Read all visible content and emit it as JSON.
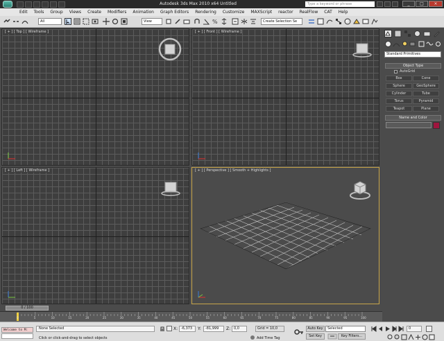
{
  "titlebar": {
    "title": "Autodesk 3ds Max 2010 x64     Untitled",
    "search_placeholder": "Type a keyword or phrase"
  },
  "menubar": {
    "items": [
      "Edit",
      "Tools",
      "Group",
      "Views",
      "Create",
      "Modifiers",
      "Animation",
      "Graph Editors",
      "Rendering",
      "Customize",
      "MAXScript",
      "reactor",
      "RealFlow",
      "CAT",
      "Help"
    ]
  },
  "toolbar": {
    "selection_filter": "All",
    "ref_coord": "View",
    "named_selection": "Create Selection Se"
  },
  "viewports": {
    "top": "[ + ] [ Top ] [ Wireframe ]",
    "front": "[ + ] [ Front ] [ Wireframe ]",
    "left": "[ + ] [ Left ] [ Wireframe ]",
    "perspective": "[ + ] [ Perspective ] [ Smooth + Highlights ]"
  },
  "command_panel": {
    "category": "Standard Primitives",
    "object_type_header": "Object Type",
    "autogrid_label": "AutoGrid",
    "buttons": [
      "Box",
      "Cone",
      "Sphere",
      "GeoSphere",
      "Cylinder",
      "Tube",
      "Torus",
      "Pyramid",
      "Teapot",
      "Plane"
    ],
    "name_color_header": "Name and Color",
    "object_color": "#a0153e"
  },
  "timeline": {
    "slider_label": "0 / 100",
    "ticks": [
      "0",
      "5",
      "10",
      "15",
      "20",
      "25",
      "30",
      "35",
      "40",
      "45",
      "50",
      "55",
      "60",
      "65",
      "70",
      "75",
      "80",
      "85",
      "90",
      "95",
      "100"
    ]
  },
  "status": {
    "listener_text": "Welcome to M:",
    "selection_info": "None Selected",
    "prompt": "Click or click-and-drag to select objects",
    "x_label": "X:",
    "x_value": "-6,373",
    "y_label": "Y:",
    "y_value": "-81,999",
    "z_label": "Z:",
    "z_value": "0,0",
    "grid_value": "Grid = 10,0",
    "add_time_tag": "Add Time Tag",
    "auto_key": "Auto Key",
    "set_key": "Set Key",
    "key_mode": "Selected",
    "key_filters": "Key Filters...",
    "frame_value": "0"
  }
}
